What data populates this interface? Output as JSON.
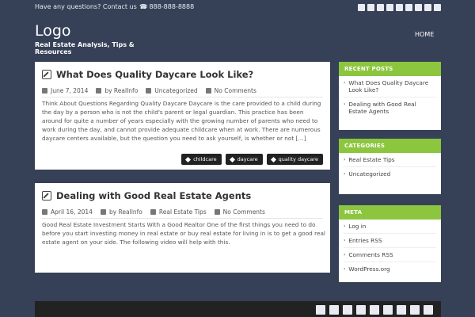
{
  "topbar": {
    "contact_text": "Have any questions? Contact us",
    "phone": "888-888-8888",
    "social_icons": [
      "facebook-icon",
      "flickr-icon",
      "youtube-icon",
      "twitter-icon",
      "linkedin-icon",
      "pinterest-icon",
      "tumblr-icon",
      "dribbble-icon",
      "instagram-icon"
    ]
  },
  "header": {
    "logo": "Logo",
    "tagline": "Real Estate Analysis, Tips & Resources",
    "nav_home": "HOME"
  },
  "posts": [
    {
      "title": "What Does Quality Daycare Look Like?",
      "date": "June 7, 2014",
      "author": "by RealInfo",
      "category": "Uncategorized",
      "comments": "No Comments",
      "excerpt": "Think About Questions Regarding Quality Daycare Daycare is the care provided to a child during the day by a person who is not the child's parent or legal guardian. This practice has been around for quite a number of years especially with the growing number of parents who need to work during the day, and cannot provide adequate childcare when at work. There are numerous daycare centers available, but the question you need to ask yourself, is whether or not […]",
      "tags": [
        "childcare",
        "daycare",
        "quality daycare"
      ]
    },
    {
      "title": "Dealing with Good Real Estate Agents",
      "date": "April 16, 2014",
      "author": "by RealInfo",
      "category": "Real Estate Tips",
      "comments": "No Comments",
      "excerpt": "Good Real Estate Investment Starts With a Good Realtor One of the first things you need to do before you start investing money in real estate or buy real estate for living in is to get a good real estate agent on your side. The following video will help with this."
    }
  ],
  "sidebar": {
    "recent_posts": {
      "heading": "RECENT POSTS",
      "items": [
        "What Does Quality Daycare Look Like?",
        "Dealing with Good Real Estate Agents"
      ]
    },
    "categories": {
      "heading": "CATEGORIES",
      "items": [
        "Real Estate Tips",
        "Uncategorized"
      ]
    },
    "meta": {
      "heading": "META",
      "items": [
        "Log in",
        "Entries RSS",
        "Comments RSS",
        "WordPress.org"
      ]
    }
  },
  "colors": {
    "background": "#364157",
    "accent": "#8cc63e",
    "footer": "#222222"
  }
}
